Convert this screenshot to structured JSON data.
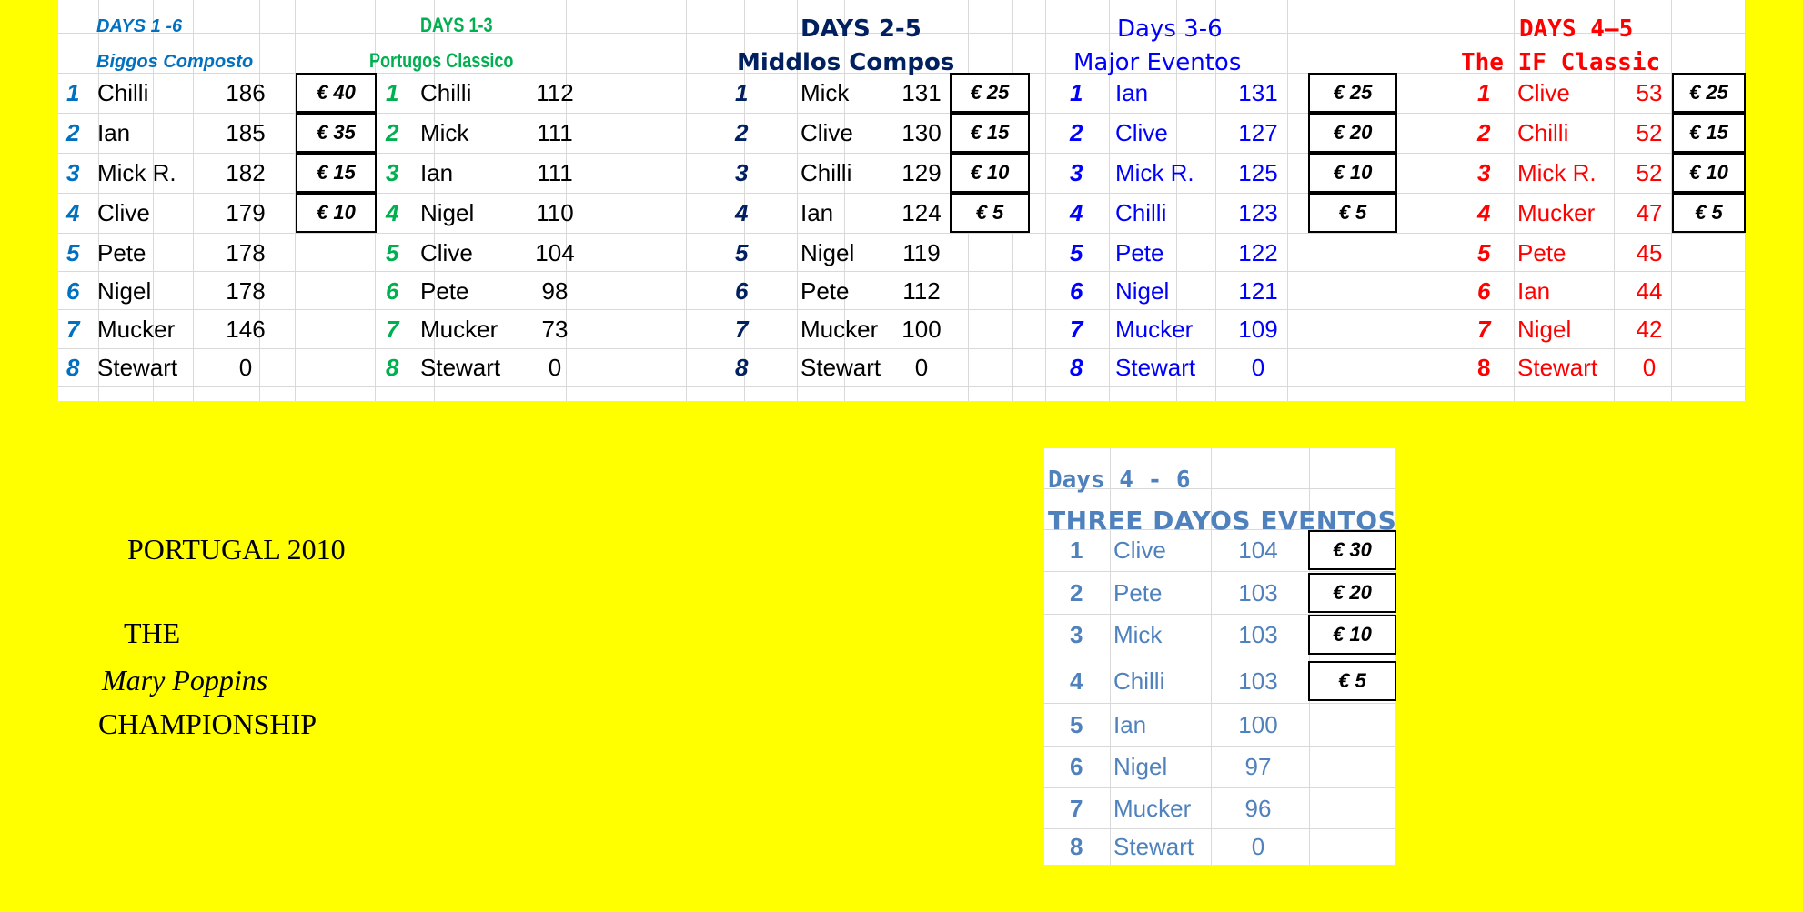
{
  "colors": {
    "background": "#ffff00",
    "sec1": "#0070c0",
    "sec2": "#00b050",
    "sec3": "#002060",
    "sec4": "#0000ff",
    "sec5": "#ff0000",
    "sec6": "#4f81bd"
  },
  "sections": [
    {
      "days": "DAYS 1 -6",
      "name": "Biggos Composto",
      "rows": [
        {
          "rank": "1",
          "player": "Chilli",
          "score": "186",
          "prize": "€ 40"
        },
        {
          "rank": "2",
          "player": "Ian",
          "score": "185",
          "prize": "€ 35"
        },
        {
          "rank": "3",
          "player": "Mick R.",
          "score": "182",
          "prize": "€ 15"
        },
        {
          "rank": "4",
          "player": "Clive",
          "score": "179",
          "prize": "€ 10"
        },
        {
          "rank": "5",
          "player": "Pete",
          "score": "178"
        },
        {
          "rank": "6",
          "player": "Nigel",
          "score": "178"
        },
        {
          "rank": "7",
          "player": "Mucker",
          "score": "146"
        },
        {
          "rank": "8",
          "player": "Stewart",
          "score": "0"
        }
      ]
    },
    {
      "days": "DAYS 1-3",
      "name": "Portugos Classico",
      "rows": [
        {
          "rank": "1",
          "player": "Chilli",
          "score": "112"
        },
        {
          "rank": "2",
          "player": "Mick",
          "score": "111"
        },
        {
          "rank": "3",
          "player": "Ian",
          "score": "111"
        },
        {
          "rank": "4",
          "player": "Nigel",
          "score": "110"
        },
        {
          "rank": "5",
          "player": "Clive",
          "score": "104"
        },
        {
          "rank": "6",
          "player": "Pete",
          "score": "98"
        },
        {
          "rank": "7",
          "player": "Mucker",
          "score": "73"
        },
        {
          "rank": "8",
          "player": "Stewart",
          "score": "0"
        }
      ]
    },
    {
      "days": "DAYS 2-5",
      "name": "Middlos Compos",
      "rows": [
        {
          "rank": "1",
          "player": "Mick",
          "score": "131",
          "prize": "€ 25"
        },
        {
          "rank": "2",
          "player": "Clive",
          "score": "130",
          "prize": "€ 15"
        },
        {
          "rank": "3",
          "player": "Chilli",
          "score": "129",
          "prize": "€ 10"
        },
        {
          "rank": "4",
          "player": "Ian",
          "score": "124",
          "prize": "€ 5"
        },
        {
          "rank": "5",
          "player": "Nigel",
          "score": "119"
        },
        {
          "rank": "6",
          "player": "Pete",
          "score": "112"
        },
        {
          "rank": "7",
          "player": "Mucker",
          "score": "100"
        },
        {
          "rank": "8",
          "player": "Stewart",
          "score": "0"
        }
      ]
    },
    {
      "days": "Days 3-6",
      "name": "Major Eventos",
      "rows": [
        {
          "rank": "1",
          "player": "Ian",
          "score": "131",
          "prize": "€ 25"
        },
        {
          "rank": "2",
          "player": "Clive",
          "score": "127",
          "prize": "€ 20"
        },
        {
          "rank": "3",
          "player": "Mick R.",
          "score": "125",
          "prize": "€ 10"
        },
        {
          "rank": "4",
          "player": "Chilli",
          "score": "123",
          "prize": "€ 5"
        },
        {
          "rank": "5",
          "player": "Pete",
          "score": "122"
        },
        {
          "rank": "6",
          "player": "Nigel",
          "score": "121"
        },
        {
          "rank": "7",
          "player": "Mucker",
          "score": "109"
        },
        {
          "rank": "8",
          "player": "Stewart",
          "score": "0"
        }
      ]
    },
    {
      "days": "DAYS 4–5",
      "name": "The IF Classic",
      "rows": [
        {
          "rank": "1",
          "player": "Clive",
          "score": "53",
          "prize": "€ 25"
        },
        {
          "rank": "2",
          "player": "Chilli",
          "score": "52",
          "prize": "€ 15"
        },
        {
          "rank": "3",
          "player": "Mick R.",
          "score": "52",
          "prize": "€ 10"
        },
        {
          "rank": "4",
          "player": "Mucker",
          "score": "47",
          "prize": "€ 5"
        },
        {
          "rank": "5",
          "player": "Pete",
          "score": "45"
        },
        {
          "rank": "6",
          "player": "Ian",
          "score": "44"
        },
        {
          "rank": "7",
          "player": "Nigel",
          "score": "42"
        },
        {
          "rank": "8",
          "player": "Stewart",
          "score": "0"
        }
      ]
    },
    {
      "days": "Days 4 - 6",
      "name": "THREE DAYOS EVENTOS",
      "rows": [
        {
          "rank": "1",
          "player": "Clive",
          "score": "104",
          "prize": "€ 30"
        },
        {
          "rank": "2",
          "player": "Pete",
          "score": "103",
          "prize": "€ 20"
        },
        {
          "rank": "3",
          "player": "Mick",
          "score": "103",
          "prize": "€ 10"
        },
        {
          "rank": "4",
          "player": "Chilli",
          "score": "103",
          "prize": "€ 5"
        },
        {
          "rank": "5",
          "player": "Ian",
          "score": "100"
        },
        {
          "rank": "6",
          "player": "Nigel",
          "score": "97"
        },
        {
          "rank": "7",
          "player": "Mucker",
          "score": "96"
        },
        {
          "rank": "8",
          "player": "Stewart",
          "score": "0"
        }
      ]
    }
  ],
  "poster": {
    "line1": "PORTUGAL 2010",
    "line2": "THE",
    "line3": "Mary Poppins",
    "line4": "CHAMPIONSHIP"
  }
}
